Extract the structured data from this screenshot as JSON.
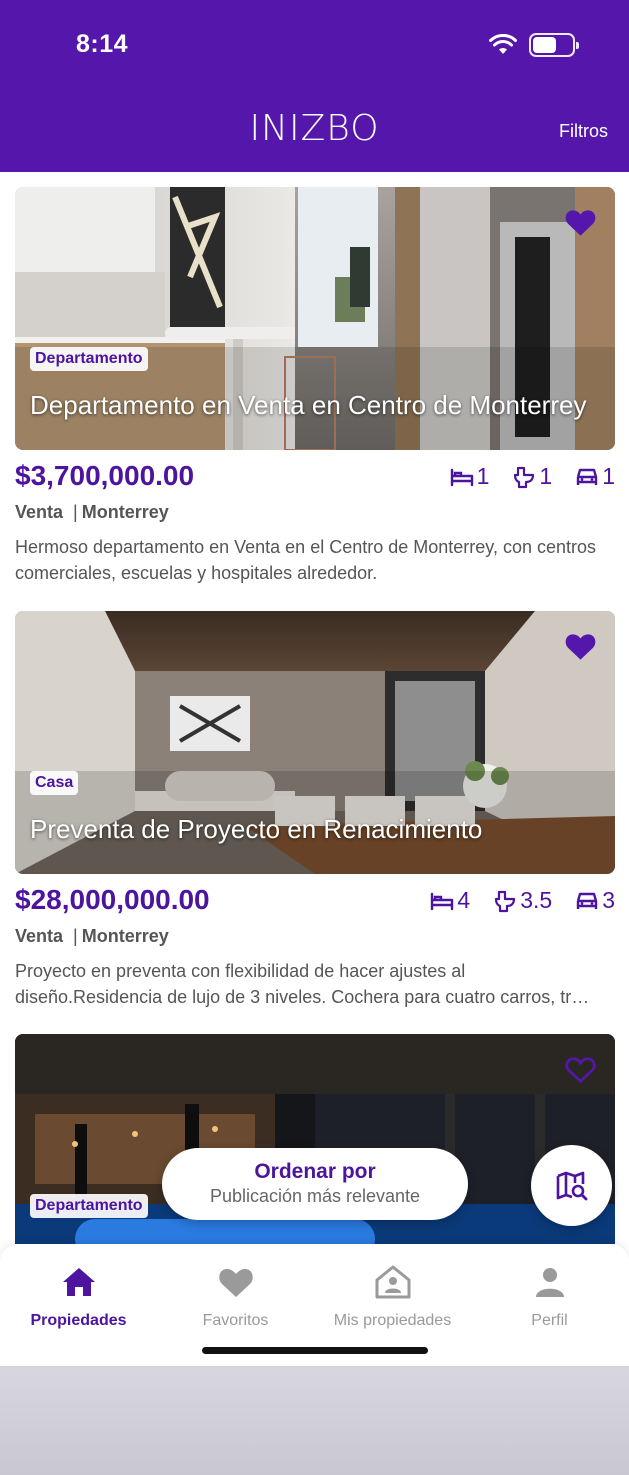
{
  "status_bar": {
    "time": "8:14",
    "battery_level": 0.6
  },
  "header": {
    "brand": "INIZBO",
    "filters_label": "Filtros"
  },
  "colors": {
    "brand": "#5517ab",
    "accent_text": "#4c149f",
    "muted": "#555555"
  },
  "listings": [
    {
      "type": "Departamento",
      "title": "Departamento en Venta en Centro de Monterrey",
      "price": "$3,700,000.00",
      "bedrooms": "1",
      "bathrooms": "1",
      "parking": "1",
      "operation": "Venta",
      "separator": "|",
      "city": "Monterrey",
      "description": "Hermoso departamento en Venta en el Centro de Monterrey, con centros comerciales, escuelas y hospitales alrededor.",
      "favorite": true
    },
    {
      "type": "Casa",
      "title": "Preventa de Proyecto en Renacimiento",
      "price": "$28,000,000.00",
      "bedrooms": "4",
      "bathrooms": "3.5",
      "parking": "3",
      "operation": "Venta",
      "separator": "|",
      "city": "Monterrey",
      "description_line1": "Proyecto en preventa con flexibilidad de hacer ajustes al",
      "description_line2": "diseño.Residencia de lujo de 3 niveles. Cochera para cuatro carros, tr…",
      "favorite": true
    },
    {
      "type": "Departamento",
      "favorite": false
    }
  ],
  "sort": {
    "title": "Ordenar por",
    "value": "Publicación más relevante"
  },
  "map_button": {
    "icon": "map-search-icon"
  },
  "tabs": [
    {
      "label": "Propiedades",
      "icon": "home-icon",
      "active": true
    },
    {
      "label": "Favoritos",
      "icon": "heart-icon",
      "active": false
    },
    {
      "label": "Mis propiedades",
      "icon": "my-properties-icon",
      "active": false
    },
    {
      "label": "Perfil",
      "icon": "person-icon",
      "active": false
    }
  ]
}
